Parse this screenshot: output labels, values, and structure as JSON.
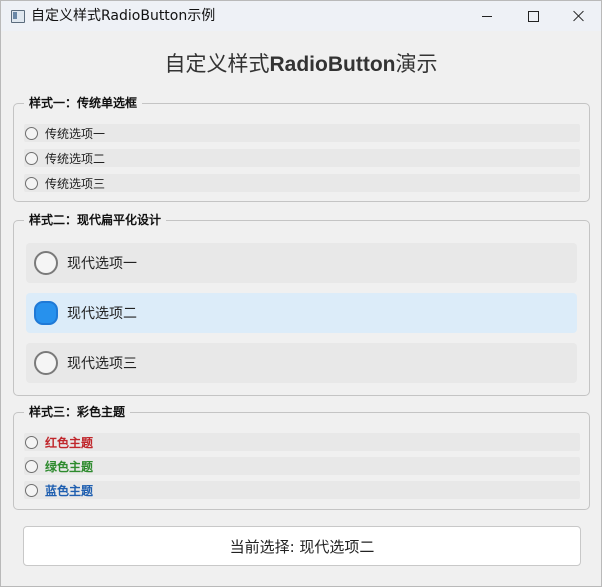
{
  "window": {
    "title": "自定义样式RadioButton示例",
    "controls": {
      "minimize": "minimize",
      "maximize": "maximize",
      "close": "close"
    }
  },
  "heading": {
    "prefix": "自定义样式",
    "bold": "RadioButton",
    "suffix": "演示"
  },
  "groups": {
    "classic": {
      "title": "样式一：传统单选框",
      "options": [
        {
          "label": "传统选项一",
          "checked": false
        },
        {
          "label": "传统选项二",
          "checked": false
        },
        {
          "label": "传统选项三",
          "checked": false
        }
      ]
    },
    "modern": {
      "title": "样式二：现代扁平化设计",
      "options": [
        {
          "label": "现代选项一",
          "checked": false
        },
        {
          "label": "现代选项二",
          "checked": true
        },
        {
          "label": "现代选项三",
          "checked": false
        }
      ]
    },
    "color": {
      "title": "样式三：彩色主题",
      "options": [
        {
          "label": "红色主题",
          "color": "#c0262b",
          "checked": false
        },
        {
          "label": "绿色主题",
          "color": "#2e8b2e",
          "checked": false
        },
        {
          "label": "蓝色主题",
          "color": "#1f5fb0",
          "checked": false
        }
      ]
    }
  },
  "status": {
    "text": "当前选择: 现代选项二"
  },
  "colors": {
    "accent": "#2791ed",
    "selected_row": "#dcecf9",
    "option_row": "#e8e8e8"
  }
}
